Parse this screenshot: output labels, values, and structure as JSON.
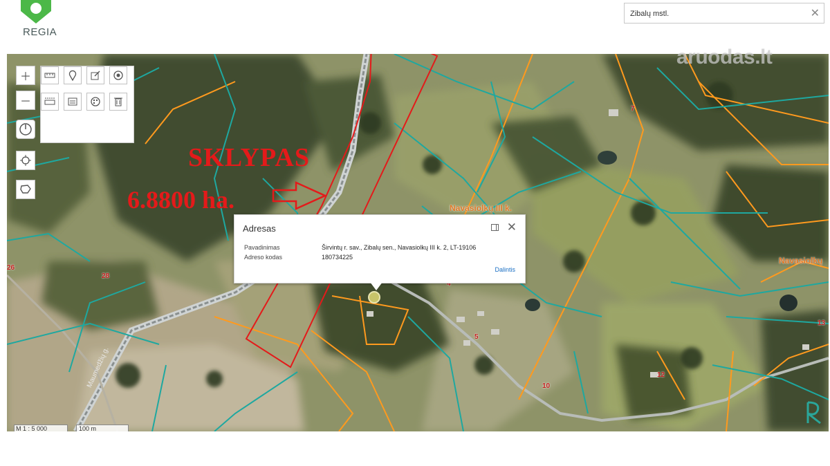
{
  "app": {
    "logo_text": "REGIA",
    "watermark": "aruodas.lt"
  },
  "search": {
    "value": "Zibalų mstl."
  },
  "annotations": {
    "parcel_label": "SKLYPAS",
    "area_label": "6.8800 ha."
  },
  "map_labels": {
    "place1": "Navasiolkų III k.",
    "place2": "Navasiolkų",
    "numbers": [
      "26",
      "28",
      "7",
      "4",
      "5",
      "10",
      "12",
      "13"
    ],
    "road": "Maumedžių g."
  },
  "popup": {
    "title": "Adresas",
    "rows": [
      {
        "key": "Pavadinimas",
        "value": "Širvintų r. sav., Zibalų sen., Navasiolkų III k. 2, LT-19106"
      },
      {
        "key": "Adreso kodas",
        "value": "180734225"
      }
    ],
    "share_label": "Dalintis"
  },
  "scale": {
    "ratio": "M 1 : 5 000",
    "bar": "100 m"
  },
  "colors": {
    "parcel_outline": "#e41a1a",
    "cadastre_orange": "#ff9a1e",
    "cadastre_teal": "#1ea8a0",
    "link": "#1a6fc4"
  },
  "icons": [
    "zoom-in-icon",
    "zoom-out-icon",
    "measure-length-icon",
    "marker-icon",
    "edit-icon",
    "target-icon",
    "measure-area-icon",
    "print-icon",
    "palette-icon",
    "trash-icon",
    "compass-icon",
    "locate-icon",
    "lasso-icon",
    "close-icon",
    "expand-icon"
  ]
}
